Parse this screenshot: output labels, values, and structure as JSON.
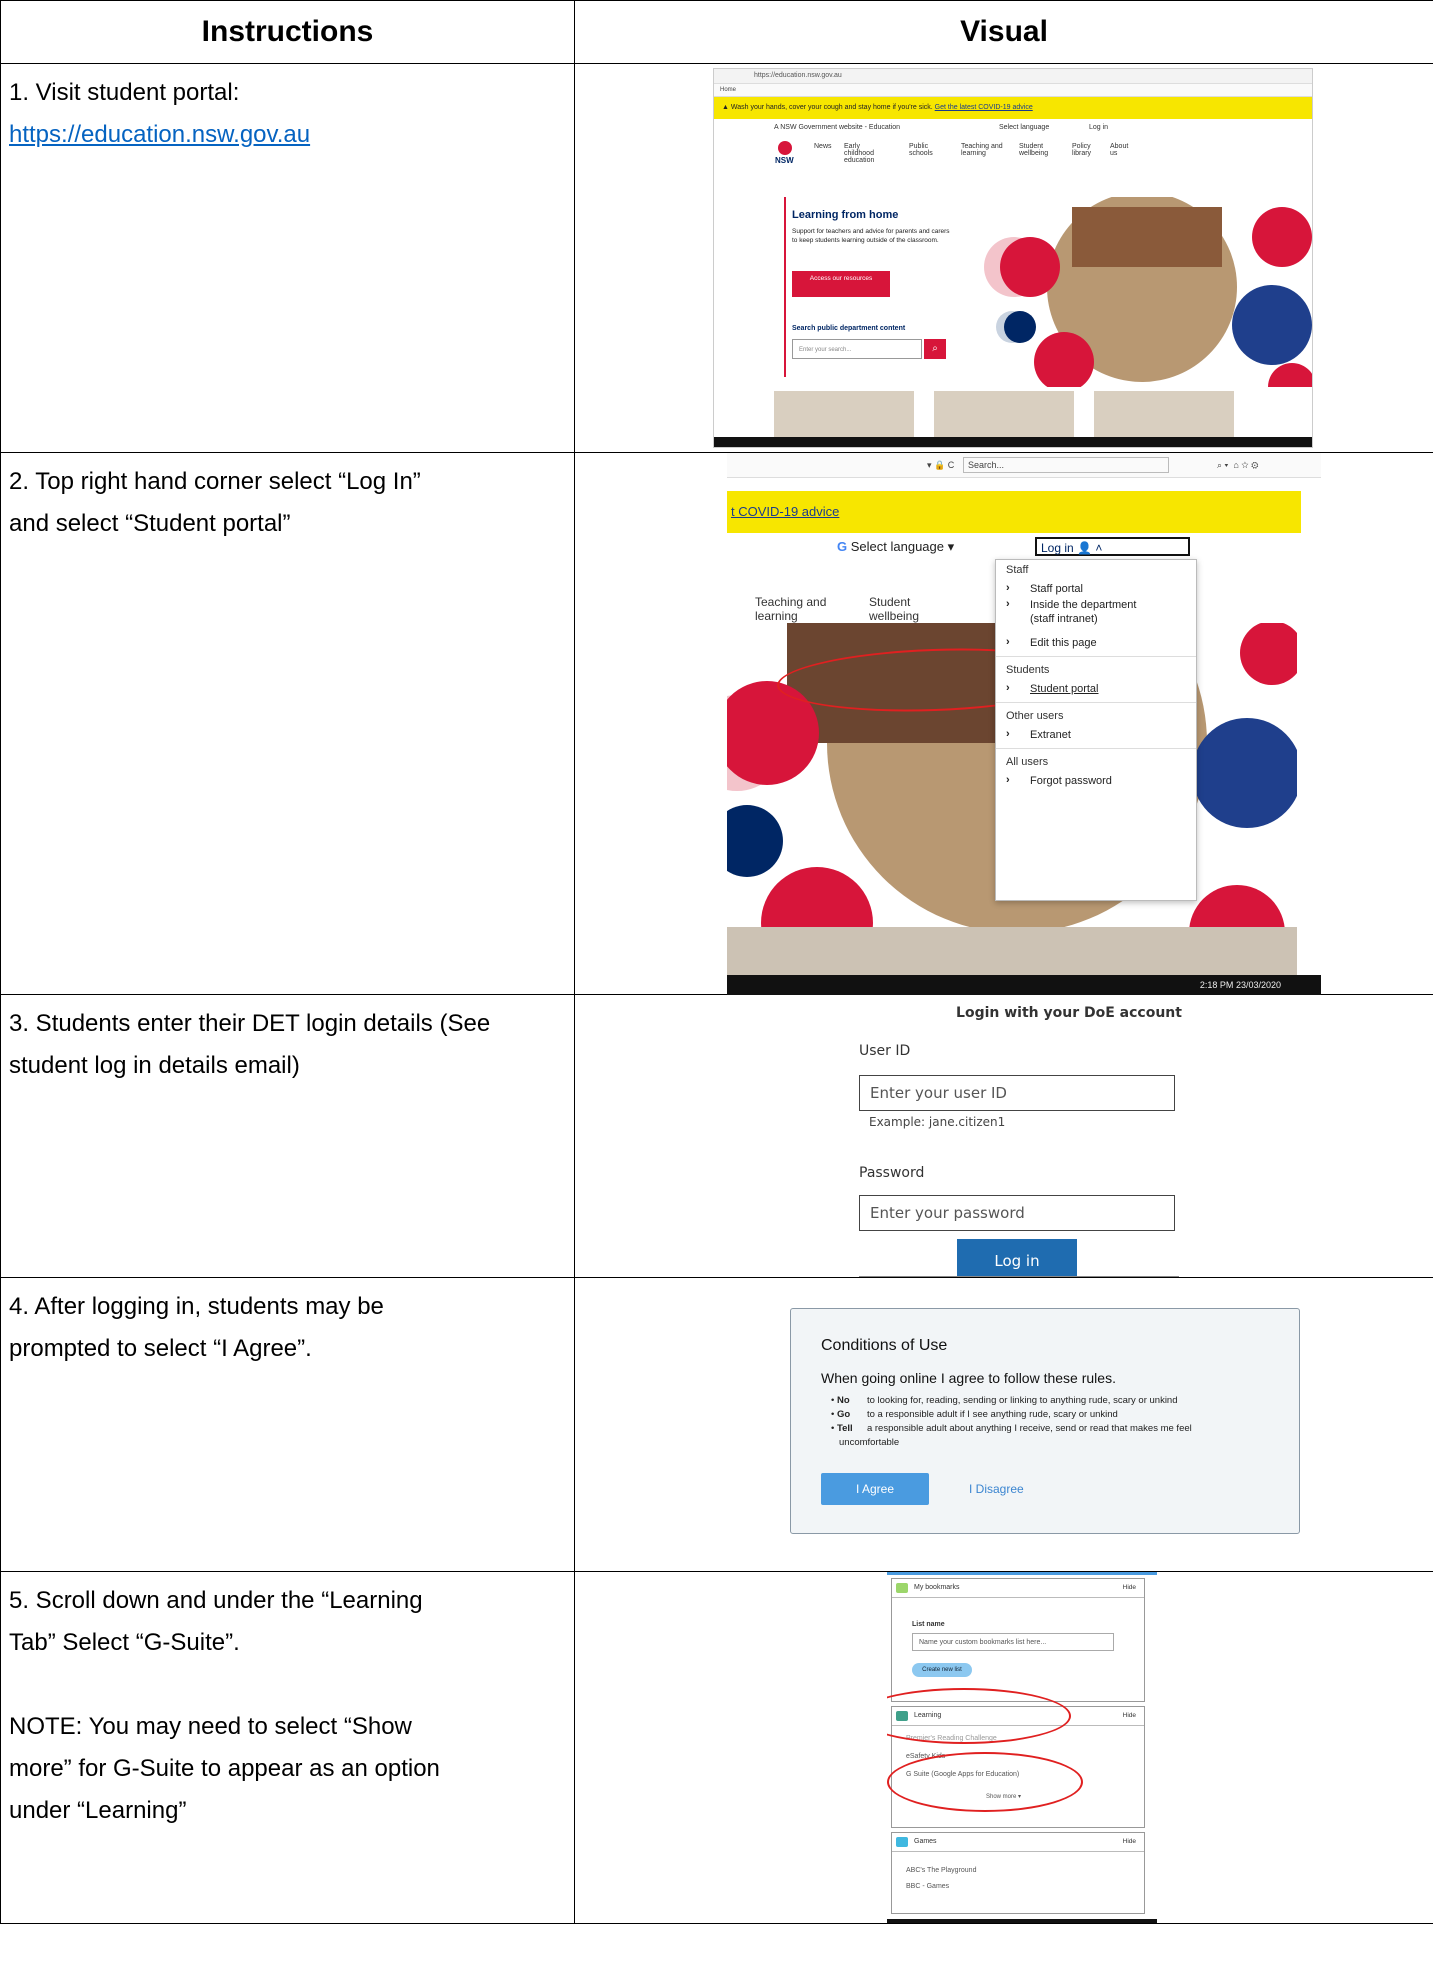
{
  "header": {
    "instructions": "Instructions",
    "visual": "Visual"
  },
  "rows": [
    {
      "line1": "1. Visit student portal:",
      "link": "https://education.nsw.gov.au"
    },
    {
      "line1": "2. Top right hand corner select “Log In”",
      "line2": "and select “Student portal”"
    },
    {
      "line1": "3. Students enter their DET login details (See",
      "line2": "student log in details email)"
    },
    {
      "line1": "4. After logging in, students may be",
      "line2": "prompted to select “I Agree”."
    },
    {
      "line1": "5. Scroll down and under the “Learning",
      "line2": "Tab” Select “G-Suite”.",
      "note1": "NOTE: You may need to select “Show",
      "note2": "more” for G-Suite to appear as an option",
      "note3": "under “Learning”"
    }
  ],
  "shot1": {
    "url": "https://education.nsw.gov.au",
    "tab": "Home",
    "banner": "Wash your hands, cover your cough and stay home if you're sick.",
    "banner_link": "Get the latest COVID-19 advice",
    "gov_label": "A NSW Government website - Education",
    "select_language": "Select language",
    "log_in": "Log in",
    "nav": [
      "News",
      "Early childhood education",
      "Public schools",
      "Teaching and learning",
      "Student wellbeing",
      "Policy library",
      "About us"
    ],
    "hero_title": "Learning from home",
    "hero_text": "Support for teachers and advice for parents and carers to keep students learning outside of the classroom.",
    "hero_button": "Access our resources",
    "search_label": "Search public department content",
    "search_placeholder": "Enter your search..."
  },
  "shot2": {
    "search": "Search...",
    "banner_link": "t COVID-19 advice",
    "select_language": "Select language",
    "log_in": "Log in",
    "nav1": "Teaching and learning",
    "nav2": "Student wellbeing",
    "staff": "Staff",
    "staff_portal": "Staff portal",
    "inside": "Inside the department (staff intranet)",
    "edit": "Edit this page",
    "students": "Students",
    "student_portal": "Student portal",
    "other_users": "Other users",
    "extranet": "Extranet",
    "all_users": "All users",
    "forgot": "Forgot password",
    "time": "2:18 PM",
    "date": "23/03/2020"
  },
  "shot3": {
    "title": "Login with your DoE account",
    "user_label": "User ID",
    "user_placeholder": "Enter your user ID",
    "example": "Example: jane.citizen1",
    "pass_label": "Password",
    "pass_placeholder": "Enter your password",
    "button": "Log in"
  },
  "shot4": {
    "title": "Conditions of Use",
    "subtitle": "When going online I agree to follow these rules.",
    "rules": [
      {
        "k": "No",
        "v": "to looking for, reading, sending or linking to anything rude, scary or unkind"
      },
      {
        "k": "Go",
        "v": "to a responsible adult if I see anything rude, scary or unkind"
      },
      {
        "k": "Tell",
        "v": "a responsible adult about anything I receive, send or read that makes me feel"
      }
    ],
    "rule_cont": "uncomfortable",
    "agree": "I Agree",
    "disagree": "I Disagree"
  },
  "shot5": {
    "bookmarks": "My bookmarks",
    "hide": "Hide",
    "list_name": "List name",
    "list_placeholder": "Name your custom bookmarks list here...",
    "create": "Create new list",
    "learning": "Learning",
    "premier": "Premier's Reading Challenge",
    "esafety": "eSafety Kids",
    "gsuite": "G Suite (Google Apps for Education)",
    "show_more": "Show more ▾",
    "games": "Games",
    "abc": "ABC's The Playground",
    "bbc": "BBC - Games"
  },
  "colors": {
    "nsw_red": "#d7153a",
    "nsw_navy": "#002664",
    "covid_yellow": "#f7e600",
    "link_blue": "#0563c1",
    "circle_red": "#e02020"
  }
}
